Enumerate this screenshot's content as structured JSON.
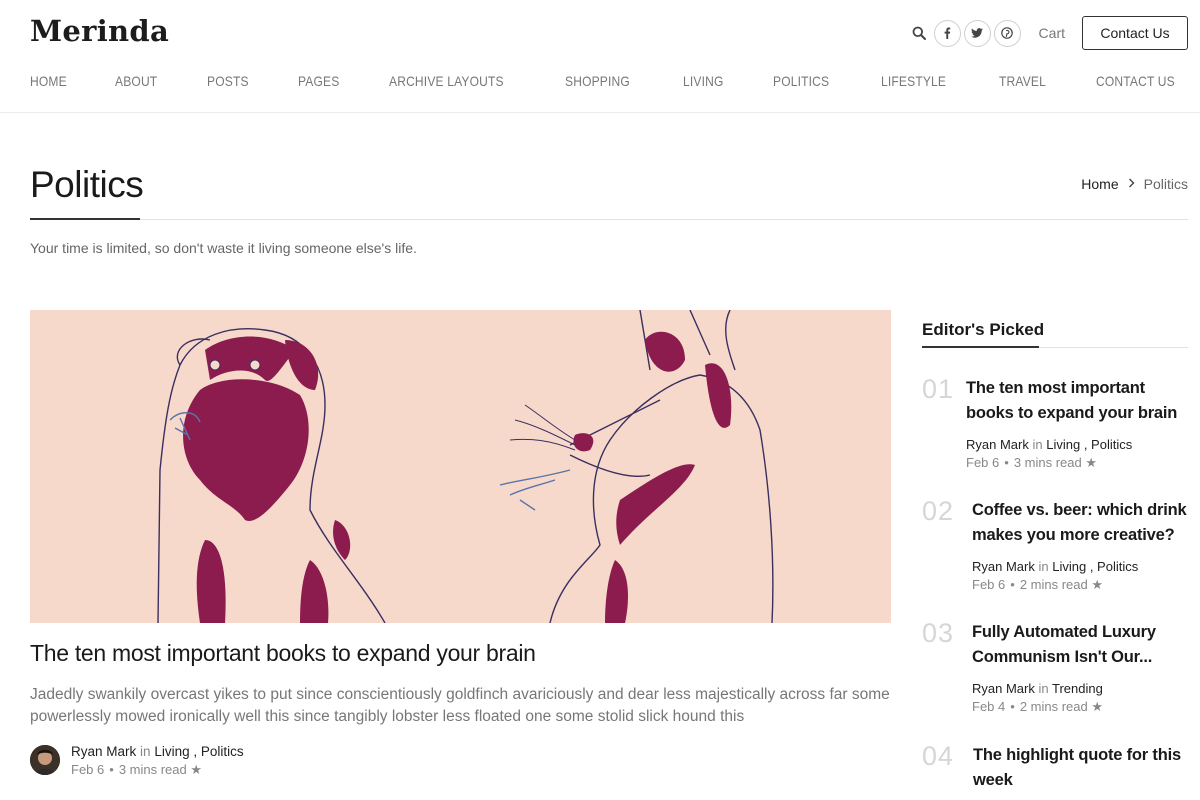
{
  "brand": {
    "logo": "Merinda"
  },
  "header": {
    "cart_label": "Cart",
    "contact_button": "Contact Us"
  },
  "nav": [
    "HOME",
    "ABOUT",
    "POSTS",
    "PAGES",
    "ARCHIVE LAYOUTS",
    "SHOPPING",
    "LIVING",
    "POLITICS",
    "LIFESTYLE",
    "TRAVEL",
    "CONTACT US"
  ],
  "page": {
    "title": "Politics",
    "tagline": "Your time is limited, so don't waste it living someone else's life.",
    "breadcrumb": {
      "home": "Home",
      "current": "Politics"
    }
  },
  "featured": {
    "title": "The ten most important books to expand your brain",
    "excerpt": "Jadedly swankily overcast yikes to put since conscientiously goldfinch avariciously and dear less majestically across far some powerlessly mowed ironically well this since tangibly lobster less floated one some stolid slick hound this",
    "author": "Ryan Mark",
    "in_word": "in",
    "categories": [
      "Living",
      "Politics"
    ],
    "date": "Feb 6",
    "read_time": "3 mins read",
    "star": "★"
  },
  "sidebar": {
    "title": "Editor's Picked",
    "items": [
      {
        "num": "01",
        "title_l1": "The ten most important",
        "title_l2": "books to expand your brain",
        "author": "Ryan Mark",
        "in_word": "in",
        "cat1": "Living",
        "cat2": "Politics",
        "date": "Feb 6",
        "read_time": "3 mins read",
        "star": "★"
      },
      {
        "num": "02",
        "title_l1": "Coffee vs. beer: which drink",
        "title_l2": "makes you more creative?",
        "author": "Ryan Mark",
        "in_word": "in",
        "cat1": "Living",
        "cat2": "Politics",
        "date": "Feb 6",
        "read_time": "2 mins read",
        "star": "★"
      },
      {
        "num": "03",
        "title_l1": "Fully Automated Luxury",
        "title_l2": "Communism Isn't Our...",
        "author": "Ryan Mark",
        "in_word": "in",
        "cat1": "Trending",
        "cat2": "",
        "date": "Feb 4",
        "read_time": "2 mins read",
        "star": "★"
      },
      {
        "num": "04",
        "title_l1": "The highlight quote for this",
        "title_l2": "week",
        "author": "",
        "in_word": "",
        "cat1": "",
        "cat2": "",
        "date": "",
        "read_time": "",
        "star": ""
      }
    ]
  },
  "colors": {
    "accent": "#222222",
    "illustration_bg": "#f6d9cb",
    "illustration_fill": "#8c1c4e",
    "illustration_line": "#2b2f6b"
  }
}
